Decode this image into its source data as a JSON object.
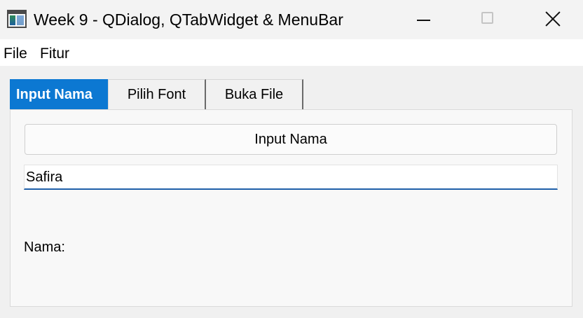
{
  "window": {
    "title": "Week 9 - QDialog, QTabWidget & MenuBar",
    "app_icon": "app-window-icon",
    "controls": [
      "minimize-icon",
      "maximize-icon",
      "close-icon"
    ]
  },
  "menubar": {
    "items": [
      {
        "label": "File"
      },
      {
        "label": "Fitur"
      }
    ]
  },
  "tabs": [
    {
      "label": "Input Nama",
      "active": true
    },
    {
      "label": "Pilih Font",
      "active": false
    },
    {
      "label": "Buka File",
      "active": false
    }
  ],
  "panel": {
    "button_label": "Input Nama",
    "input_value": "Safira",
    "nama_label": "Nama:"
  },
  "colors": {
    "active_tab": "#0c78d2",
    "input_underline": "#1f5fa9"
  }
}
